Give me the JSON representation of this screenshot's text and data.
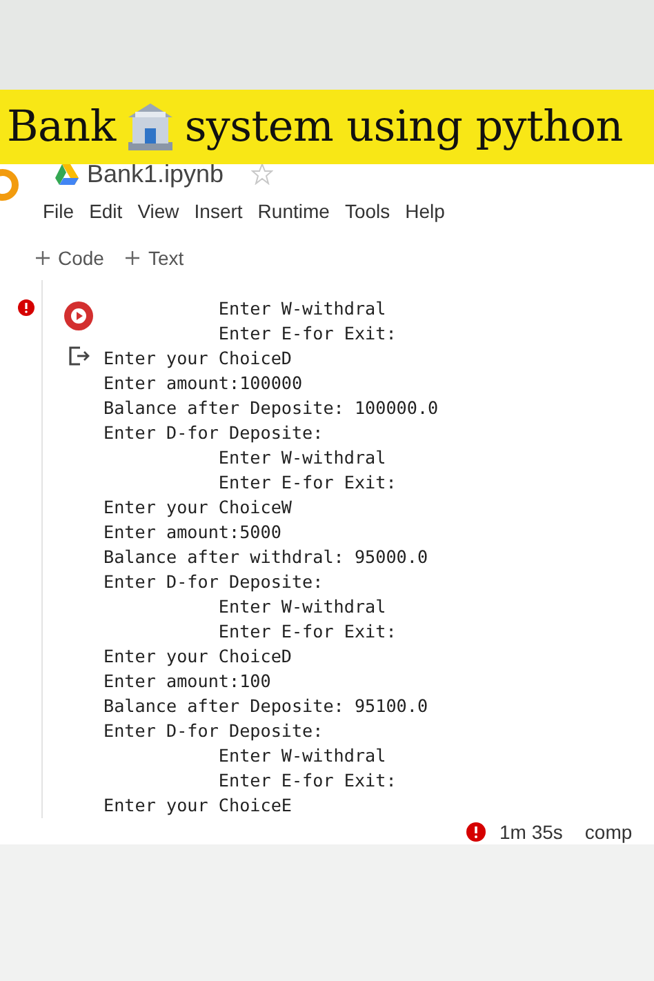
{
  "banner": {
    "before": "Bank",
    "after": "system using python"
  },
  "notebook": {
    "title": "Bank1.ipynb",
    "starred": false
  },
  "menu": [
    "File",
    "Edit",
    "View",
    "Insert",
    "Runtime",
    "Tools",
    "Help"
  ],
  "toolbar": [
    "Code",
    "Text"
  ],
  "cell": {
    "error": true,
    "output": [
      "           Enter W-withdral",
      "           Enter E-for Exit:",
      "Enter your ChoiceD",
      "Enter amount:100000",
      "Balance after Deposite: 100000.0",
      "Enter D-for Deposite:",
      "           Enter W-withdral",
      "           Enter E-for Exit:",
      "Enter your ChoiceW",
      "Enter amount:5000",
      "Balance after withdral: 95000.0",
      "Enter D-for Deposite:",
      "           Enter W-withdral",
      "           Enter E-for Exit:",
      "Enter your ChoiceD",
      "Enter amount:100",
      "Balance after Deposite: 95100.0",
      "Enter D-for Deposite:",
      "           Enter W-withdral",
      "           Enter E-for Exit:",
      "Enter your ChoiceE"
    ]
  },
  "status_bar": {
    "error": true,
    "duration": "1m 35s",
    "message": "comp"
  }
}
